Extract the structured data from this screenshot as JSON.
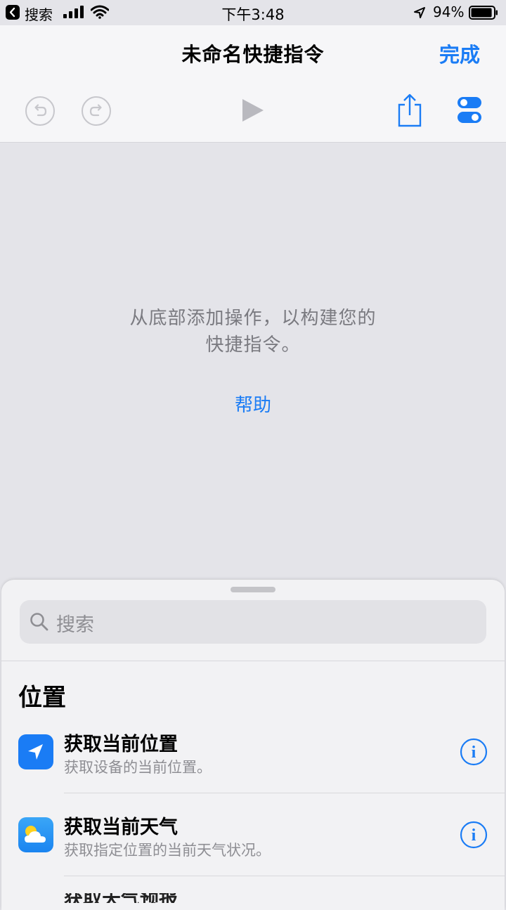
{
  "status_bar": {
    "back_app": "搜索",
    "time": "下午3:48",
    "battery": "94%",
    "battery_level": 0.94
  },
  "nav": {
    "title": "未命名快捷指令",
    "done": "完成"
  },
  "toolbar": {
    "icons": [
      "undo-icon",
      "redo-icon",
      "play-icon",
      "share-icon",
      "settings-toggle-icon"
    ]
  },
  "empty_state": {
    "hint_line1": "从底部添加操作，以构建您的",
    "hint_line2": "快捷指令。",
    "help": "帮助"
  },
  "sheet": {
    "search_placeholder": "搜索",
    "section": "位置",
    "actions": [
      {
        "title": "获取当前位置",
        "subtitle": "获取设备的当前位置。",
        "icon": "location-arrow-icon",
        "icon_color": "#1a7cf5"
      },
      {
        "title": "获取当前天气",
        "subtitle": "获取指定位置的当前天气状况。",
        "icon": "weather-icon",
        "icon_color": "#2f9bf5"
      }
    ],
    "partial_item": "获取天气预报"
  },
  "colors": {
    "accent": "#1a7cf5",
    "canvas": "#e4e4e9",
    "disabled": "#c7c7cc"
  }
}
